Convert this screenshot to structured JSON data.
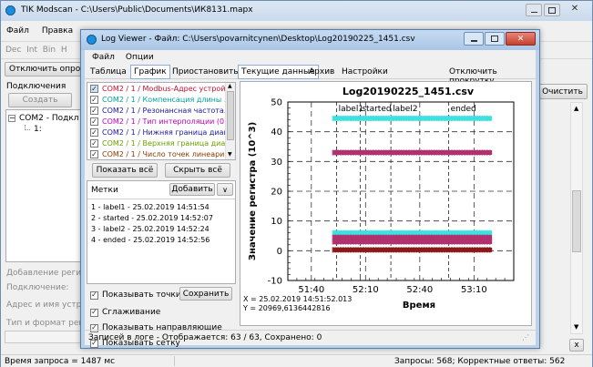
{
  "main": {
    "title": "ТIK Modscan - C:\\Users\\Public\\Documents\\ИК8131.mapx",
    "menu": [
      "Файл",
      "Правка"
    ],
    "toolbar": "Dec  Int  Bin  H",
    "disconnect_label": "Отключить опро",
    "connections_label": "Подключения",
    "create_label": "Создать",
    "tree_root": "COM2 - Подкл",
    "tree_child": "1:",
    "clear_label": "Очистить",
    "add_register": "Добавление регис",
    "connection_label": "Подключение:",
    "address_label": "Адрес и имя устро",
    "type_label": "Тип и формат реги",
    "status_left": "Время запроса = 1487 мс",
    "status_right": "Запросы: 568; Корректные ответы: 562",
    "close_x": "x"
  },
  "viewer": {
    "title": "Log Viewer - Файл: C:\\Users\\povarnitcynen\\Desktop\\Log20190225_1451.csv",
    "menu": [
      "Файл",
      "Опции"
    ],
    "tabs": [
      "Таблица",
      "График",
      "Приостановить",
      "Текущие данные",
      "Архив",
      "Настройки"
    ],
    "disable_scroll": "Отключить прокрутку",
    "series": [
      {
        "label": "COM2 / 1 / Modbus-Адрес устрой...",
        "color": "#c8102e"
      },
      {
        "label": "COM2 / 1 / Компенсация длины ...",
        "color": "#00a0a0"
      },
      {
        "label": "COM2 / 1 / Резонансная частота...",
        "color": "#1a1aa0"
      },
      {
        "label": "COM2 / 1 / Тип интерполяции (0 -...",
        "color": "#c000c0"
      },
      {
        "label": "COM2 / 1 / Нижняя граница диап...",
        "color": "#1a1aa0"
      },
      {
        "label": "COM2 / 1 / Верхняя граница диа...",
        "color": "#6aa000"
      },
      {
        "label": "COM2 / 1 / Число точек линеари...",
        "color": "#8a3a00"
      }
    ],
    "show_all": "Показать всё",
    "hide_all": "Скрыть всё",
    "marks_label": "Метки",
    "add_label": "Добавить",
    "marks": [
      "1 - label1 - 25.02.2019 14:51:54",
      "2 - started - 25.02.2019 14:52:07",
      "3 - label2 - 25.02.2019 14:52:24",
      "4 - ended - 25.02.2019 14:52:56"
    ],
    "options": [
      "Показывать точки",
      "Сглаживание",
      "Показывать направляющие",
      "Показывать сетку"
    ],
    "save_label": "Сохранить",
    "status": "Записей в логе - Отображается: 63 / 63, Сохранено: 0",
    "cursor_x": "X = 25.02.2019 14:51:52.013",
    "cursor_y": "Y = 20969,6136442816"
  },
  "chart_data": {
    "type": "line",
    "title": "Log20190225_1451.csv",
    "xlabel": "Время",
    "ylabel": "Значение регистра (10^3)",
    "x_ticks": [
      "51:40",
      "52:10",
      "52:40",
      "53:10"
    ],
    "x_tick_seconds": [
      0,
      30,
      60,
      90
    ],
    "xlim_seconds": [
      -13,
      112
    ],
    "ylim": [
      -10,
      50
    ],
    "y_ticks": [
      -10,
      0,
      10,
      20,
      30,
      40,
      50
    ],
    "grid": true,
    "markers": [
      {
        "label": "label1",
        "t": 14
      },
      {
        "label": "started",
        "t": 27
      },
      {
        "label": "label2",
        "t": 44
      },
      {
        "label": "ended",
        "t": 76
      }
    ],
    "series": [
      {
        "color": "#3ee0e0",
        "values": [
          44.5
        ]
      },
      {
        "color": "#b03070",
        "values": [
          33
        ]
      },
      {
        "color": "#3ee0e0",
        "values": [
          6
        ]
      },
      {
        "color": "#b03070",
        "values": [
          4.5
        ]
      },
      {
        "color": "#b03070",
        "values": [
          3
        ]
      },
      {
        "color": "#8a1a1a",
        "values": [
          0.3
        ]
      }
    ],
    "series_t_range": [
      12,
      100
    ]
  },
  "icons": {
    "app": "app-icon",
    "minimize": "minimize-icon",
    "maximize": "maximize-icon",
    "close": "close-icon"
  }
}
